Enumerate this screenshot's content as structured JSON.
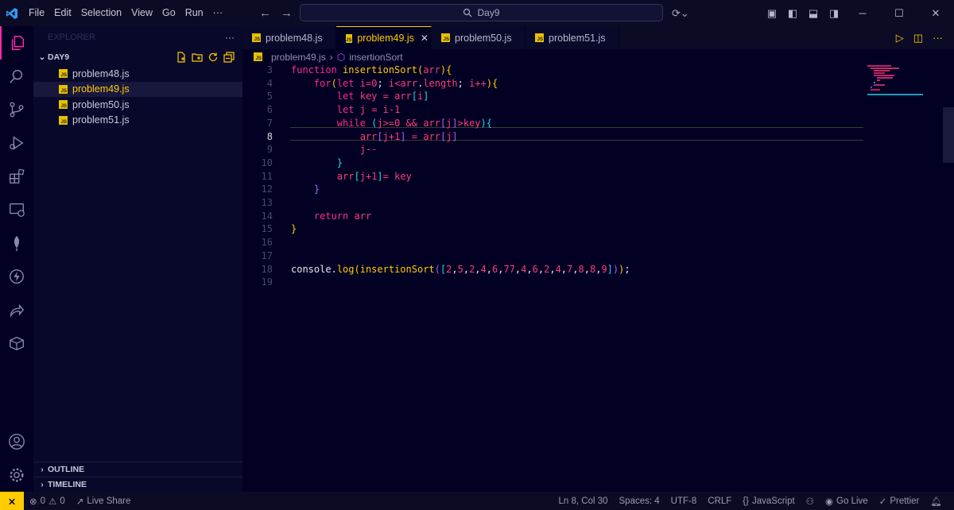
{
  "menu": [
    "File",
    "Edit",
    "Selection",
    "View",
    "Go",
    "Run",
    "···"
  ],
  "search": {
    "text": "Day9"
  },
  "sidebar": {
    "header": "EXPLORER",
    "folder": "DAY9",
    "files": [
      {
        "name": "problem48.js",
        "active": false
      },
      {
        "name": "problem49.js",
        "active": true
      },
      {
        "name": "problem50.js",
        "active": false
      },
      {
        "name": "problem51.js",
        "active": false
      }
    ],
    "outline": "OUTLINE",
    "timeline": "TIMELINE"
  },
  "tabs": [
    {
      "label": "problem48.js",
      "active": false
    },
    {
      "label": "problem49.js",
      "active": true
    },
    {
      "label": "problem50.js",
      "active": false
    },
    {
      "label": "problem51.js",
      "active": false
    }
  ],
  "breadcrumb": {
    "file": "problem49.js",
    "symbol": "insertionSort"
  },
  "code": {
    "current_line": 8,
    "lines": [
      {
        "n": "3",
        "html": "<span class='k'>function</span> <span class='f'>insertionSort</span><span class='p'>(</span><span class='v'>arr</span><span class='p'>){</span>"
      },
      {
        "n": "4",
        "html": "    <span class='k'>for</span><span class='p'>(</span><span class='k'>let</span> <span class='v'>i</span><span class='o'>=</span><span class='n'>0</span><span class='t'>;</span> <span class='v'>i</span><span class='o'>&lt;</span><span class='v'>arr</span><span class='t'>.</span><span class='v'>length</span><span class='t'>;</span> <span class='v'>i</span><span class='o'>++</span><span class='p'>){</span>"
      },
      {
        "n": "5",
        "html": "        <span class='k'>let</span> <span class='v'>key</span> <span class='o'>=</span> <span class='v'>arr</span><span class='b'>[</span><span class='v'>i</span><span class='b'>]</span>"
      },
      {
        "n": "6",
        "html": "        <span class='k'>let</span> <span class='v'>j</span> <span class='o'>=</span> <span class='v'>i</span><span class='o'>-</span><span class='n'>1</span>"
      },
      {
        "n": "7",
        "html": "        <span class='k'>while</span> <span class='b'>(</span><span class='v'>j</span><span class='o'>&gt;=</span><span class='n'>0</span> <span class='o'>&amp;&amp;</span> <span class='v'>arr</span><span class='pu'>[</span><span class='v'>j</span><span class='pu'>]</span><span class='o'>&gt;</span><span class='v'>key</span><span class='b'>){</span>"
      },
      {
        "n": "8",
        "html": "            <span class='v'>arr</span><span class='pu'>[</span><span class='v'>j</span><span class='o'>+</span><span class='n'>1</span><span class='pu'>]</span> <span class='o'>=</span> <span class='v'>arr</span><span class='pu'>[</span><span class='v'>j</span><span class='pu'>]</span>"
      },
      {
        "n": "9",
        "html": "            <span class='v'>j</span><span class='o'>--</span>"
      },
      {
        "n": "10",
        "html": "        <span class='b'>}</span>"
      },
      {
        "n": "11",
        "html": "        <span class='v'>arr</span><span class='b'>[</span><span class='v'>j</span><span class='o'>+</span><span class='n'>1</span><span class='b'>]</span><span class='o'>=</span> <span class='v'>key</span>"
      },
      {
        "n": "12",
        "html": "    <span class='pu'>}</span>"
      },
      {
        "n": "13",
        "html": ""
      },
      {
        "n": "14",
        "html": "    <span class='k'>return</span> <span class='v'>arr</span>"
      },
      {
        "n": "15",
        "html": "<span class='p'>}</span>"
      },
      {
        "n": "16",
        "html": ""
      },
      {
        "n": "17",
        "html": ""
      },
      {
        "n": "18",
        "html": "<span class='t'>console</span><span class='t'>.</span><span class='f'>log</span><span class='p'>(</span><span class='f'>insertionSort</span><span class='pu'>(</span><span class='b'>[</span><span class='n'>2</span><span class='t'>,</span><span class='n'>5</span><span class='t'>,</span><span class='n'>2</span><span class='t'>,</span><span class='n'>4</span><span class='t'>,</span><span class='n'>6</span><span class='t'>,</span><span class='n'>77</span><span class='t'>,</span><span class='n'>4</span><span class='t'>,</span><span class='n'>6</span><span class='t'>,</span><span class='n'>2</span><span class='t'>,</span><span class='n'>4</span><span class='t'>,</span><span class='n'>7</span><span class='t'>,</span><span class='n'>8</span><span class='t'>,</span><span class='n'>8</span><span class='t'>,</span><span class='n'>9</span><span class='b'>]</span><span class='pu'>)</span><span class='p'>)</span><span class='t'>;</span>"
      },
      {
        "n": "19",
        "html": ""
      }
    ]
  },
  "status": {
    "errors": "0",
    "warnings": "0",
    "live_share": "Live Share",
    "position": "Ln 8, Col 30",
    "spaces": "Spaces: 4",
    "encoding": "UTF-8",
    "eol": "CRLF",
    "language": "JavaScript",
    "go_live": "Go Live",
    "prettier": "Prettier"
  },
  "colors": {
    "accent": "#ffcc00",
    "keyword": "#ff2a8b",
    "background": "#020023"
  }
}
